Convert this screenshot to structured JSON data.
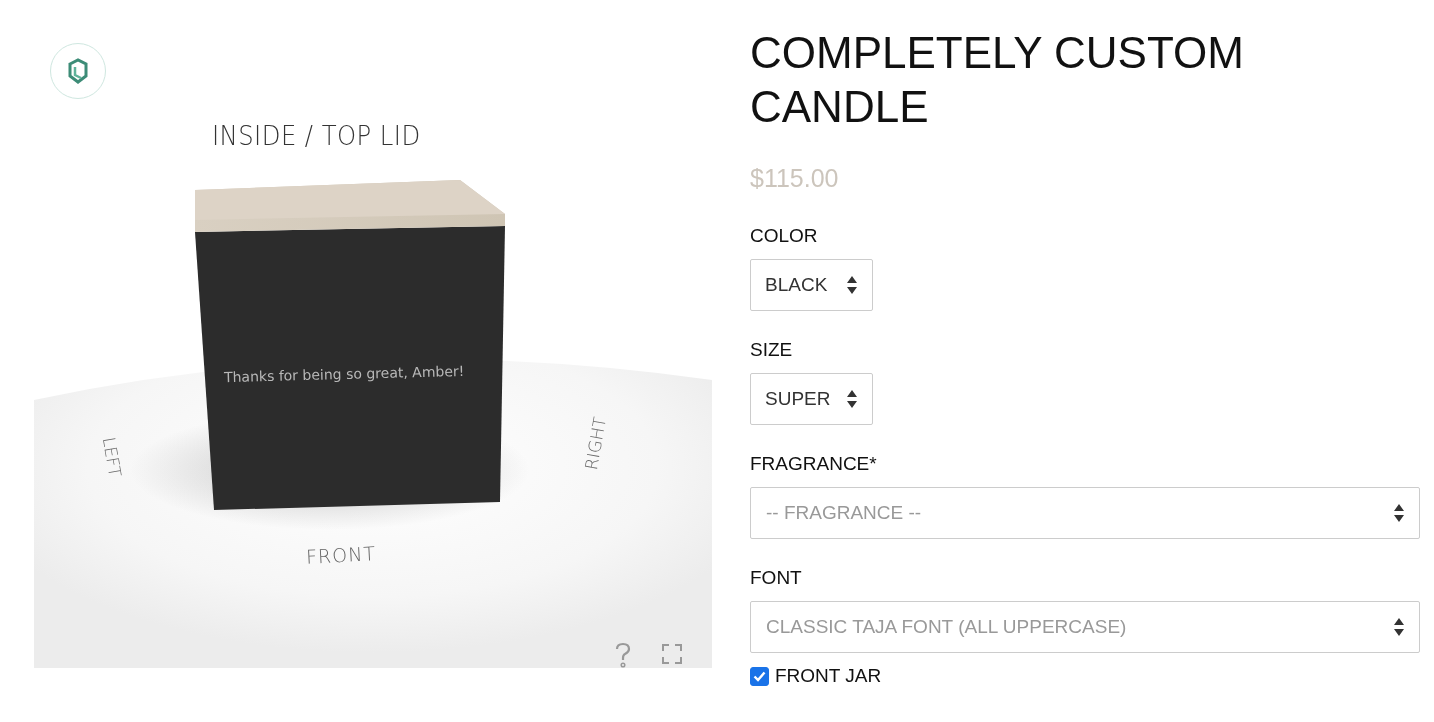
{
  "viewer": {
    "view_label": "INSIDE / TOP LID",
    "engraving": "Thanks for being so great, Amber!",
    "side_labels": [
      {
        "kind": "left",
        "text": "LEFT"
      },
      {
        "kind": "right",
        "text": "RIGHT"
      },
      {
        "kind": "front",
        "text": "FRONT"
      }
    ]
  },
  "product": {
    "title": "COMPLETELY CUSTOM CANDLE",
    "price": "$115.00"
  },
  "options": [
    {
      "kind": "compact",
      "label": "COLOR",
      "value": "BLACK"
    },
    {
      "kind": "compact",
      "label": "SIZE",
      "value": "SUPER"
    },
    {
      "kind": "wide",
      "label": "FRAGRANCE*",
      "placeholder": "-- FRAGRANCE --"
    },
    {
      "kind": "wide",
      "label": "FONT",
      "placeholder": "CLASSIC TAJA FONT (ALL UPPERCASE)"
    }
  ],
  "checkboxes": [
    {
      "label": "FRONT JAR",
      "checked": true
    }
  ]
}
